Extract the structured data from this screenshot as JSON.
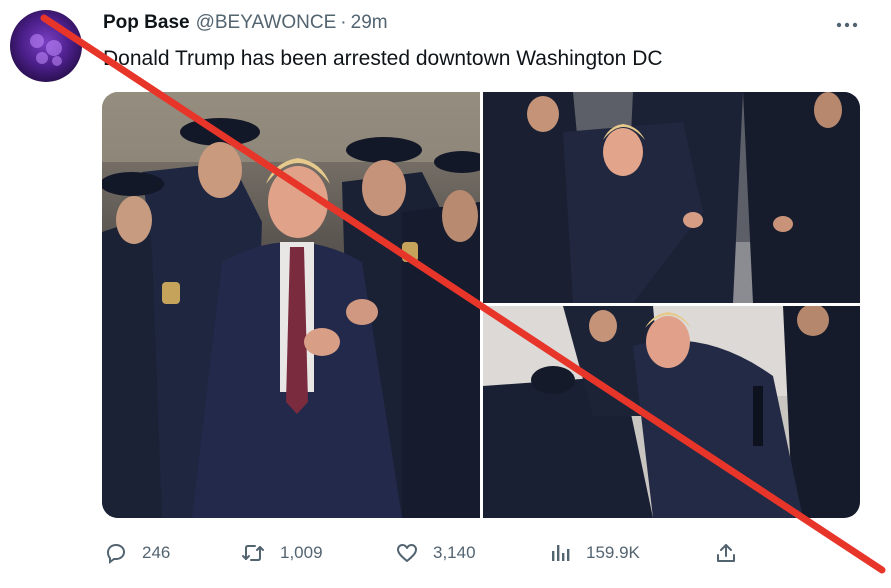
{
  "tweet": {
    "display_name": "Pop Base",
    "handle": "@BEYAWONCE",
    "separator": "·",
    "time": "29m",
    "text": "Donald Trump has been arrested downtown Washington DC"
  },
  "icons": {
    "avatar": "profile-avatar",
    "more": "more-icon",
    "reply": "reply-icon",
    "retweet": "retweet-icon",
    "like": "like-icon",
    "views": "views-icon",
    "share": "share-icon"
  },
  "actions": {
    "reply_count": "246",
    "retweet_count": "1,009",
    "like_count": "3,140",
    "views_count": "159.9K"
  },
  "colors": {
    "text_primary": "#0f1419",
    "text_secondary": "#536471",
    "strike_line": "#e8352a"
  }
}
